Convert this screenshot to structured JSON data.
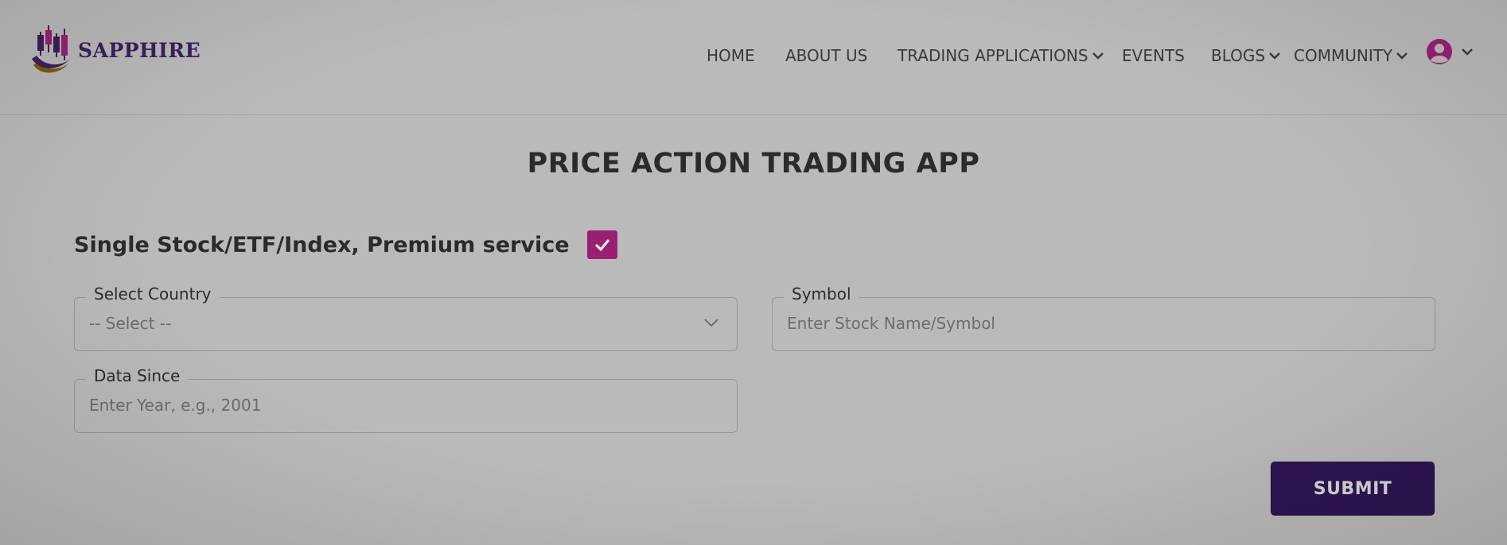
{
  "brand": {
    "name": "SAPPHIRE",
    "logo_icon": "candlestick-logo"
  },
  "nav": {
    "items": [
      {
        "label": "HOME",
        "dropdown": false
      },
      {
        "label": "ABOUT US",
        "dropdown": false
      },
      {
        "label": "TRADING APPLICATIONS",
        "dropdown": true
      },
      {
        "label": "EVENTS",
        "dropdown": false
      },
      {
        "label": "BLOGS",
        "dropdown": true
      },
      {
        "label": "COMMUNITY",
        "dropdown": true
      }
    ],
    "account_icon": "user-circle-icon"
  },
  "page": {
    "title": "PRICE ACTION TRADING APP"
  },
  "form": {
    "service_label": "Single Stock/ETF/Index, Premium service",
    "service_checked": true,
    "country": {
      "legend": "Select Country",
      "value": "-- Select --"
    },
    "symbol": {
      "legend": "Symbol",
      "placeholder": "Enter Stock Name/Symbol"
    },
    "data_since": {
      "legend": "Data Since",
      "placeholder": "Enter Year, e.g., 2001"
    },
    "submit_label": "SUBMIT"
  },
  "colors": {
    "brand_purple": "#3d1f5c",
    "accent_magenta": "#9a1f72",
    "submit_bg": "#2e1653",
    "overlay_bg": "#bababa"
  }
}
